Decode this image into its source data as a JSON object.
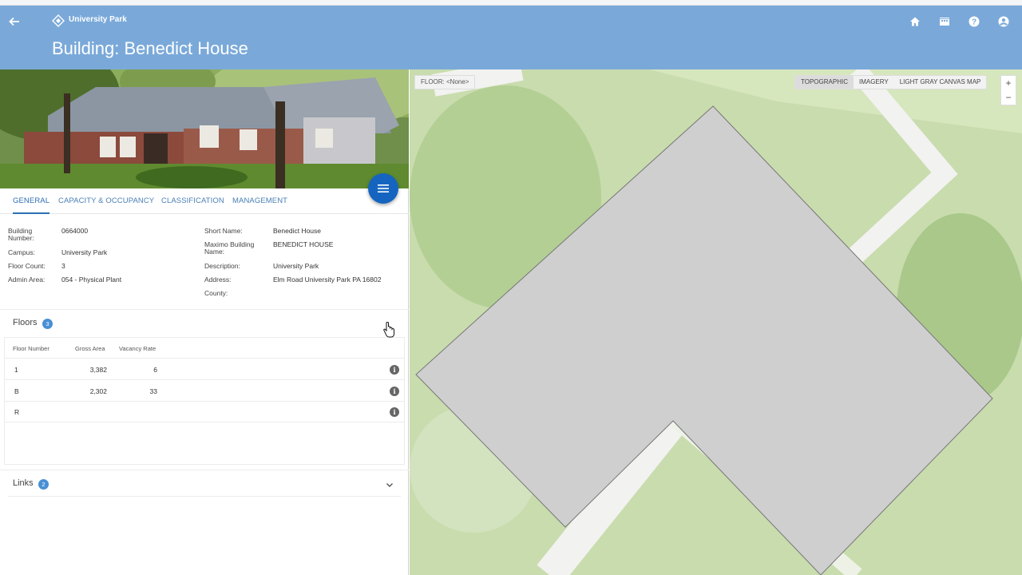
{
  "header": {
    "brand": "University Park",
    "title": "Building: Benedict House"
  },
  "tabs": [
    {
      "label": "GENERAL",
      "active": true
    },
    {
      "label": "CAPACITY & OCCUPANCY"
    },
    {
      "label": "CLASSIFICATION"
    },
    {
      "label": "MANAGEMENT"
    }
  ],
  "general": {
    "building_number_label": "Building Number:",
    "building_number": "0664000",
    "campus_label": "Campus:",
    "campus": "University Park",
    "floor_count_label": "Floor Count:",
    "floor_count": "3",
    "admin_area_label": "Admin Area:",
    "admin_area": "054 - Physical Plant",
    "short_name_label": "Short Name:",
    "short_name": "Benedict House",
    "maximo_label": "Maximo Building Name:",
    "maximo": "BENEDICT HOUSE",
    "description_label": "Description:",
    "description": "University Park",
    "address_label": "Address:",
    "address": "Elm Road University Park PA 16802",
    "county_label": "County:",
    "county": ""
  },
  "floors": {
    "title": "Floors",
    "count": "3",
    "columns": [
      "Floor Number",
      "Gross Area",
      "Vacancy Rate"
    ],
    "rows": [
      {
        "floor": "1",
        "gross": "3,382",
        "vacancy": "6"
      },
      {
        "floor": "B",
        "gross": "2,302",
        "vacancy": "33"
      },
      {
        "floor": "R",
        "gross": "",
        "vacancy": ""
      }
    ]
  },
  "links": {
    "title": "Links",
    "count": "2"
  },
  "map": {
    "floor_chip": "FLOOR: <None>",
    "basemaps": [
      "TOPOGRAPHIC",
      "IMAGERY",
      "LIGHT GRAY CANVAS MAP"
    ],
    "zoom_in": "+",
    "zoom_out": "−"
  },
  "colors": {
    "header": "#7aa9d9",
    "accent": "#2f6fb3",
    "fab": "#1565c0",
    "badge": "#4a8fd4",
    "map_grass": "#c9dcae",
    "building_fill": "#cfcfcf"
  }
}
